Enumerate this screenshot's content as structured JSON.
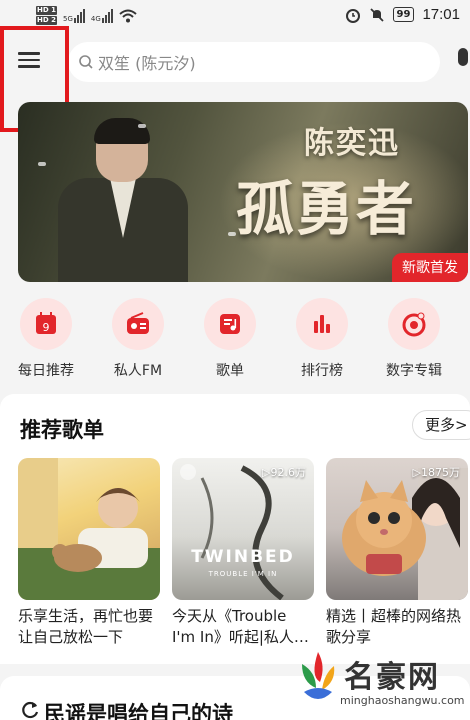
{
  "status_bar": {
    "hd1": "HD 1",
    "hd2": "HD 2",
    "net1": "5G",
    "net2": "4G",
    "battery": "99",
    "time": "17:01"
  },
  "header": {
    "menu_icon": "menu-icon",
    "search_placeholder": "双笙 (陈元汐)",
    "search_icon": "search-icon",
    "mic_icon": "mic-icon"
  },
  "banner": {
    "artist": "陈奕迅",
    "album": "孤勇者",
    "tag": "新歌首发"
  },
  "quick": [
    {
      "label": "每日推荐",
      "icon": "calendar-icon"
    },
    {
      "label": "私人FM",
      "icon": "radio-icon"
    },
    {
      "label": "歌单",
      "icon": "playlist-icon"
    },
    {
      "label": "排行榜",
      "icon": "chart-bars-icon"
    },
    {
      "label": "数字专辑",
      "icon": "disc-icon"
    }
  ],
  "recommend": {
    "title": "推荐歌单",
    "more": "更多>",
    "cards": [
      {
        "title": "乐享生活，再忙也要让自己放松一下",
        "count": ""
      },
      {
        "title": "今天从《Trouble I'm In》听起|私人…",
        "count": "▷92.6万",
        "cover_text": "TWINBED",
        "cover_sub": "TROUBLE I'M IN"
      },
      {
        "title": "精选丨超棒的网络热歌分享",
        "count": "▷1875万"
      }
    ]
  },
  "next_section": {
    "title": "民谣是唱给自己的诗"
  },
  "watermark": {
    "text": "名豪网",
    "url": "minghaoshangwu.com"
  },
  "colors": {
    "accent": "#e2262b",
    "icon_bg": "#fde3e2"
  }
}
